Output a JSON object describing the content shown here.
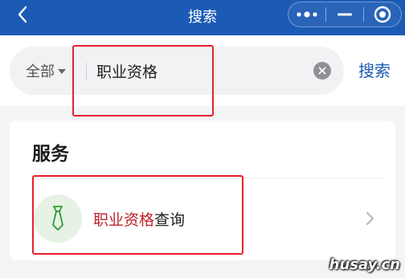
{
  "header": {
    "title": "搜索",
    "back_icon": "chevron-left-icon",
    "more_icon": "more-dots-icon",
    "minimize_icon": "minimize-icon",
    "close_icon": "target-circle-icon",
    "background": "#1c5bb5"
  },
  "search": {
    "scope": "全部",
    "query": "职业资格",
    "submit_label": "搜索",
    "clear_icon": "clear-icon"
  },
  "services": {
    "title": "服务",
    "items": [
      {
        "label_highlight": "职业资格",
        "label_rest": "查询",
        "icon": "tie-icon",
        "chevron_icon": "chevron-right-icon"
      }
    ]
  },
  "watermark": "husay.cn",
  "colors": {
    "accent": "#1c5bb5",
    "highlight": "#c0242c",
    "annotation": "#e8202a"
  }
}
